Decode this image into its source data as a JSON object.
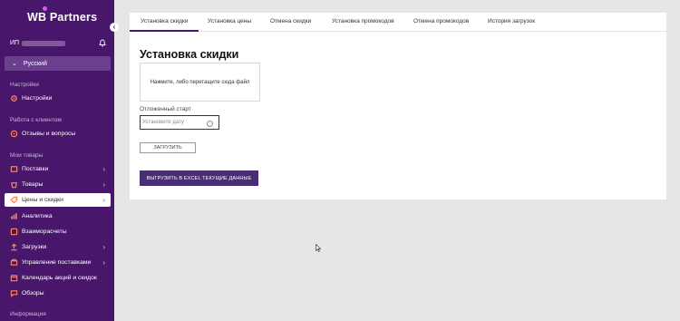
{
  "brand": {
    "logo_text": "WB Partners",
    "color": "#48166b"
  },
  "user": {
    "prefix": "ИП"
  },
  "language": {
    "label": "Русский"
  },
  "sidebar": {
    "sections": {
      "settings": "Настройки",
      "work_with_client": "Работа с клиентом",
      "my_goods": "Мои товары",
      "information": "Информация"
    },
    "items": [
      {
        "label": "Настройки",
        "icon": "gear-icon"
      },
      {
        "label": "Отзывы и вопросы",
        "icon": "reviews-icon"
      },
      {
        "label": "Поставки",
        "icon": "supply-icon"
      },
      {
        "label": "Товары",
        "icon": "goods-icon"
      },
      {
        "label": "Цены и скидки",
        "icon": "price-tag-icon"
      },
      {
        "label": "Аналитика",
        "icon": "analytics-icon"
      },
      {
        "label": "Взаиморасчеты",
        "icon": "settlements-icon"
      },
      {
        "label": "Загрузки",
        "icon": "upload-icon"
      },
      {
        "label": "Управление поставками",
        "icon": "supply-management-icon"
      },
      {
        "label": "Календарь акций и скидок",
        "icon": "calendar-icon"
      },
      {
        "label": "Обзоры",
        "icon": "reviews-icon"
      }
    ]
  },
  "tabs": [
    "Установка скидки",
    "Установка цены",
    "Отмена скидки",
    "Установка промокодов",
    "Отмена промокодов",
    "История загрузок"
  ],
  "main": {
    "title": "Установка скидки",
    "dropzone_text": "Нажмите, либо перетащите сюда файл",
    "delayed_start_label": "Отложенный старт",
    "date_placeholder": "Установите дату",
    "upload_button": "ЗАГРУЗИТЬ",
    "export_button": "ВЫГРУЗИТЬ В EXCEL ТЕКУЩИЕ ДАННЫЕ"
  }
}
